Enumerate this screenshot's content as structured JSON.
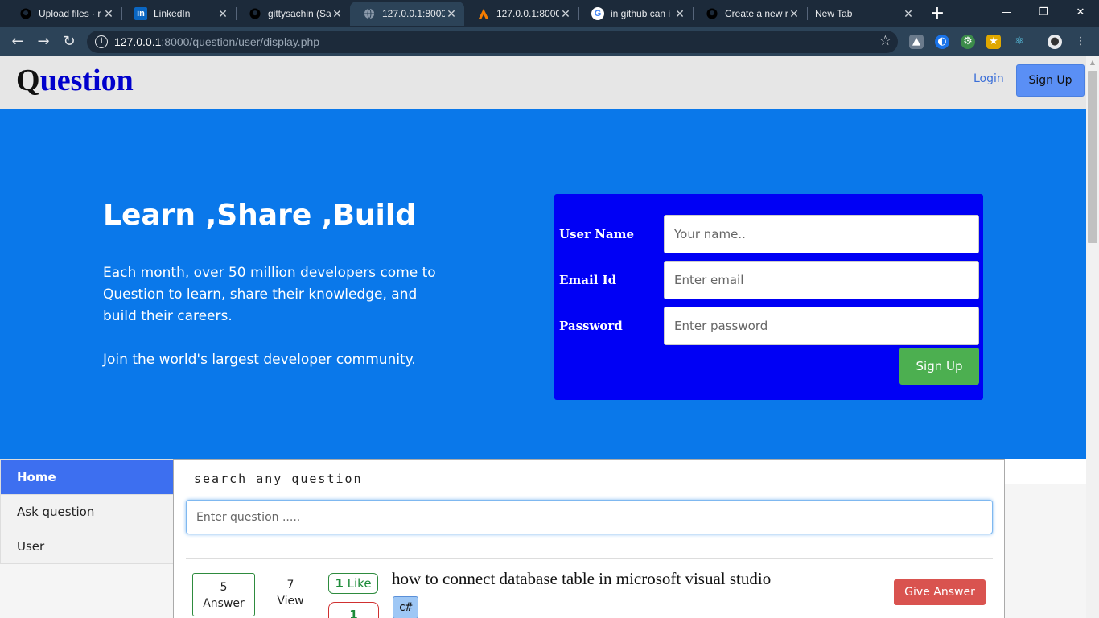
{
  "browser": {
    "tabs": [
      {
        "title": "Upload files · r",
        "icon": "github-icon",
        "active": false
      },
      {
        "title": "LinkedIn",
        "icon": "linkedin-icon",
        "active": false
      },
      {
        "title": "gittysachin (Sa",
        "icon": "github-icon",
        "active": false
      },
      {
        "title": "127.0.0.1:8000/",
        "icon": "globe-icon",
        "active": true
      },
      {
        "title": "127.0.0.1:8000",
        "icon": "xampp-icon",
        "active": false
      },
      {
        "title": "in github can i",
        "icon": "google-icon",
        "active": false
      },
      {
        "title": "Create a new r",
        "icon": "github-icon",
        "active": false
      },
      {
        "title": "New Tab",
        "icon": "",
        "active": false
      }
    ],
    "url_host": "127.0.0.1",
    "url_rest": ":8000/question/user/display.php"
  },
  "navbar": {
    "brand_first": "Q",
    "brand_rest": "uestion",
    "login": "Login",
    "signup": "Sign Up"
  },
  "hero": {
    "title": "Learn ,Share ,Build",
    "text": "Each month, over 50 million developers come to Question to learn, share their knowledge, and build their careers.",
    "join": "Join the world's largest developer community."
  },
  "signup_form": {
    "username_label": "User Name",
    "username_placeholder": "Your name..",
    "email_label": "Email Id",
    "email_placeholder": "Enter email",
    "password_label": "Password",
    "password_placeholder": "Enter password",
    "submit": "Sign Up"
  },
  "sidebar": {
    "items": [
      {
        "label": "Home",
        "active": true
      },
      {
        "label": "Ask question",
        "active": false
      },
      {
        "label": "User",
        "active": false
      }
    ]
  },
  "search": {
    "caption": "search any question",
    "placeholder": "Enter question ....."
  },
  "question": {
    "answers_count": "5",
    "answers_label": "Answer",
    "views_count": "7",
    "views_label": "View",
    "likes_count": "1",
    "likes_label": "Like",
    "dislikes_count": "1",
    "title": "how to connect database table in microsoft visual studio",
    "tag": "c#",
    "answer_button": "Give Answer"
  },
  "colors": {
    "hero_bg": "#0a78ea",
    "form_bg": "#0000f5",
    "signup_green": "#4caf50",
    "answer_red": "#d9534f",
    "sidebar_active": "#3d6ff0"
  }
}
